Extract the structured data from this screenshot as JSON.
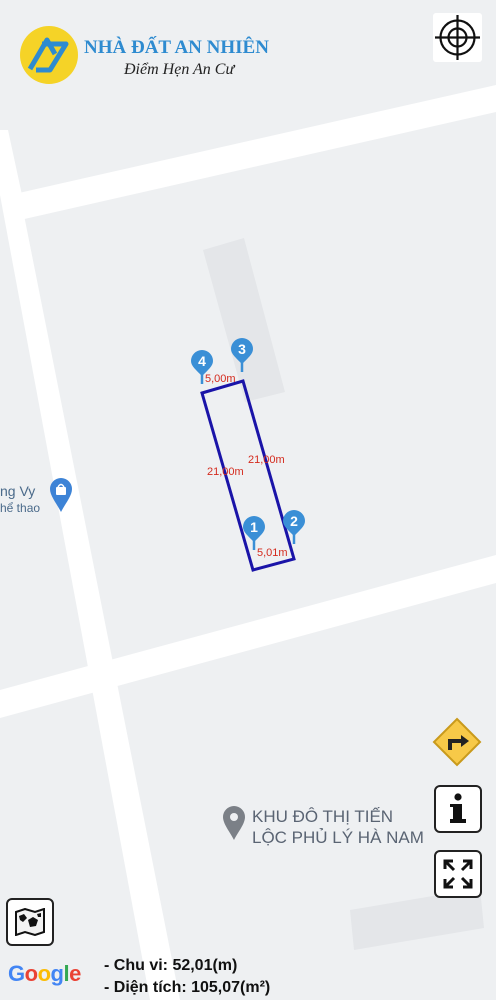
{
  "brand": {
    "name": "NHÀ ĐẤT AN NHIÊN",
    "slogan": "Điểm Hẹn An Cư",
    "name_color": "#2e8bd0",
    "logo_color": "#f5d327"
  },
  "map": {
    "land_color": "#eef0f2",
    "road_color": "#ffffff",
    "building_color": "#e4e6e9",
    "parcel_color": "#1a14a8",
    "marker_color": "#3a8fd6",
    "edge_label_color": "#d42b1e",
    "markers": [
      "1",
      "2",
      "3",
      "4"
    ],
    "edge_labels": [
      "5,01m",
      "21,00m",
      "5,00m",
      "21,00m"
    ],
    "poi_main": {
      "icon": "place-pin-icon",
      "lines": [
        "KHU ĐÔ THỊ TIẾN",
        "LỘC PHỦ LÝ HÀ NAM"
      ]
    },
    "poi_shop": {
      "icon": "shopping-bag-icon",
      "name": "ng Vy",
      "category": "hể thao"
    }
  },
  "controls": {
    "locate": "crosshair-icon",
    "directions": "turn-right-sign-icon",
    "info": "info-icon",
    "fullscreen": "fullscreen-icon",
    "map_type": "world-map-icon"
  },
  "attribution": {
    "google": [
      "G",
      "o",
      "o",
      "g",
      "l",
      "e"
    ],
    "google_colors": [
      "#4285f4",
      "#ea4335",
      "#fbbc05",
      "#4285f4",
      "#34a853",
      "#ea4335"
    ]
  },
  "stats": {
    "perimeter": "- Chu vi: 52,01(m)",
    "area": "- Diện tích: 105,07(m²)"
  }
}
